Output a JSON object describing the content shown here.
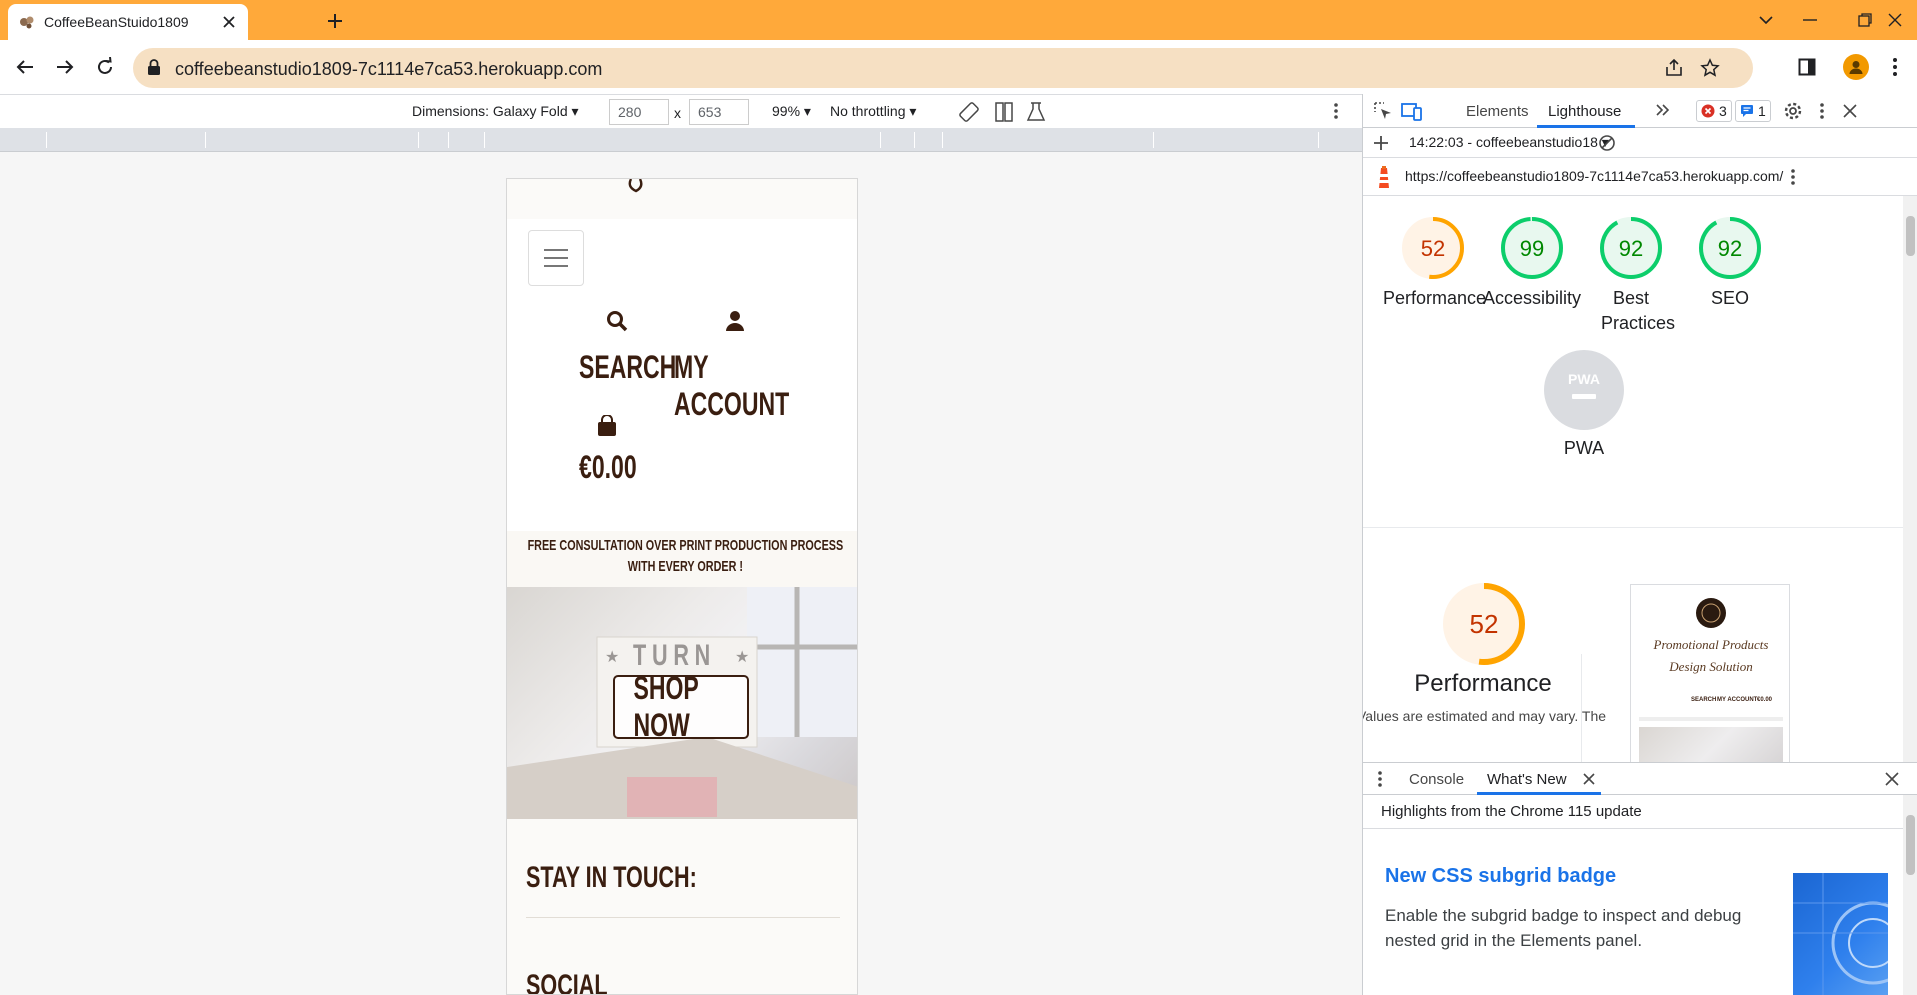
{
  "browser": {
    "tab_title": "CoffeeBeanStuido1809",
    "url": "coffeebeanstudio1809-7c1114e7ca53.herokuapp.com"
  },
  "device_toolbar": {
    "dimensions_label": "Dimensions: Galaxy Fold",
    "width": "280",
    "times": "x",
    "height": "653",
    "zoom": "99%",
    "throttling": "No throttling"
  },
  "site": {
    "nav": {
      "search_label": "SEARCH",
      "account_label": "MY ACCOUNT",
      "cart_total": "€0.00"
    },
    "banner": {
      "line1": "FREE CONSULTATION OVER PRINT PRODUCTION PROCESS",
      "line2": "WITH EVERY ORDER !"
    },
    "hero": {
      "sign_text": "TURN",
      "button_label": "SHOP NOW"
    },
    "footer": {
      "stay_in_touch": "STAY IN TOUCH:",
      "social": "SOCIAL"
    }
  },
  "devtools": {
    "tabs": [
      "Elements",
      "Lighthouse"
    ],
    "active_tab": "Lighthouse",
    "error_count": "3",
    "message_count": "1",
    "report_selector": "14:22:03 - coffeebeanstudio18",
    "report_url": "https://coffeebeanstudio1809-7c1114e7ca53.herokuapp.com/",
    "scores": [
      {
        "label": "Performance",
        "value": 52,
        "color": "#FFA400",
        "bg": "#FFF3E6",
        "text_color": "#C33300"
      },
      {
        "label": "Accessibility",
        "value": 99,
        "color": "#0CCE6B",
        "bg": "#E8F8EF",
        "text_color": "#008800"
      },
      {
        "label": "Best Practices",
        "value": 92,
        "color": "#0CCE6B",
        "bg": "#E8F8EF",
        "text_color": "#008800"
      },
      {
        "label": "SEO",
        "value": 92,
        "color": "#0CCE6B",
        "bg": "#E8F8EF",
        "text_color": "#008800"
      }
    ],
    "pwa": {
      "label": "PWA",
      "badge_text": "PWA"
    },
    "performance_detail": {
      "score": "52",
      "heading": "Performance",
      "note": "Values are estimated and may vary. The",
      "thumbnail": {
        "title_line1": "Promotional Products",
        "title_line2": "Design Solution",
        "nav": [
          "SEARCH",
          "MY ACCOUNT",
          "€0.00"
        ]
      }
    },
    "drawer": {
      "tabs": [
        "Console",
        "What's New"
      ],
      "active_tab": "What's New",
      "highlights": "Highlights from the Chrome 115 update",
      "item_title": "New CSS subgrid badge",
      "item_desc": "Enable the subgrid badge to inspect and debug nested grid in the Elements panel."
    }
  },
  "colors": {
    "tab_strip": "#FFA93A",
    "omnibox": "#F6E0C3",
    "site_text": "#3A1E10",
    "devtools_accent": "#1A73E8"
  }
}
